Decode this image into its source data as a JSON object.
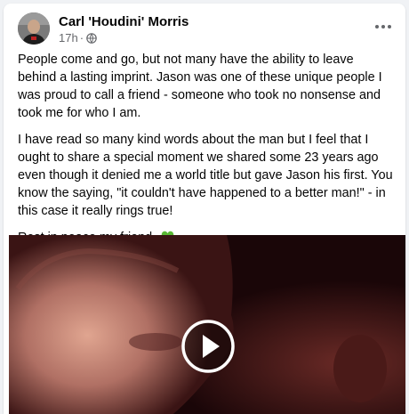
{
  "post": {
    "author": "Carl 'Houdini' Morris",
    "time": "17h",
    "separator": "·",
    "paragraphs": [
      "People come and go, but not many have the ability to leave behind a lasting imprint. Jason was one of these unique people I was proud to call a friend - someone who took no nonsense and took me for who I am.",
      "I have read so many kind words about the man but I feel that I ought to share a special moment we shared some 23 years ago even though it denied me a world title but gave Jason his first. You know the saying, \"it couldn't have happened to a better man!\" - in this case it really rings true!",
      "Rest in peace my friend."
    ]
  },
  "icons": {
    "privacy": "globe-icon",
    "more": "more-horizontal-icon",
    "emoji": "green-heart-emoji",
    "video": "play-icon"
  },
  "colors": {
    "text": "#050505",
    "meta": "#65676b",
    "heart": "#59b935",
    "video_bg": "#1a0608"
  }
}
